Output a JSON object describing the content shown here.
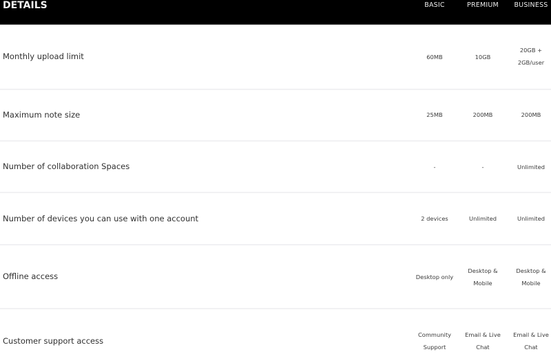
{
  "header": {
    "title": "DETAILS",
    "columns": [
      "BASIC",
      "PREMIUM",
      "BUSINESS"
    ]
  },
  "rows": [
    {
      "label": "Monthly upload limit",
      "values": [
        [
          "60MB"
        ],
        [
          "10GB"
        ],
        [
          "20GB +",
          "2GB/user"
        ]
      ]
    },
    {
      "label": "Maximum note size",
      "values": [
        [
          "25MB"
        ],
        [
          "200MB"
        ],
        [
          "200MB"
        ]
      ]
    },
    {
      "label": "Number of collaboration Spaces",
      "values": [
        [
          "-"
        ],
        [
          "-"
        ],
        [
          "Unlimited"
        ]
      ]
    },
    {
      "label": "Number of devices you can use with one account",
      "values": [
        [
          "2 devices"
        ],
        [
          "Unlimited"
        ],
        [
          "Unlimited"
        ]
      ]
    },
    {
      "label": "Offline access",
      "values": [
        [
          "Desktop only"
        ],
        [
          "Desktop &",
          "Mobile"
        ],
        [
          "Desktop &",
          "Mobile"
        ]
      ]
    },
    {
      "label": "Customer support access",
      "values": [
        [
          "Community",
          "Support"
        ],
        [
          "Email & Live",
          "Chat"
        ],
        [
          "Email & Live",
          "Chat"
        ]
      ]
    }
  ],
  "colors": {
    "header_bg": "#000000",
    "header_text": "#ffffff",
    "divider": "#f1f1f3",
    "body_text": "#2f2f2f"
  }
}
